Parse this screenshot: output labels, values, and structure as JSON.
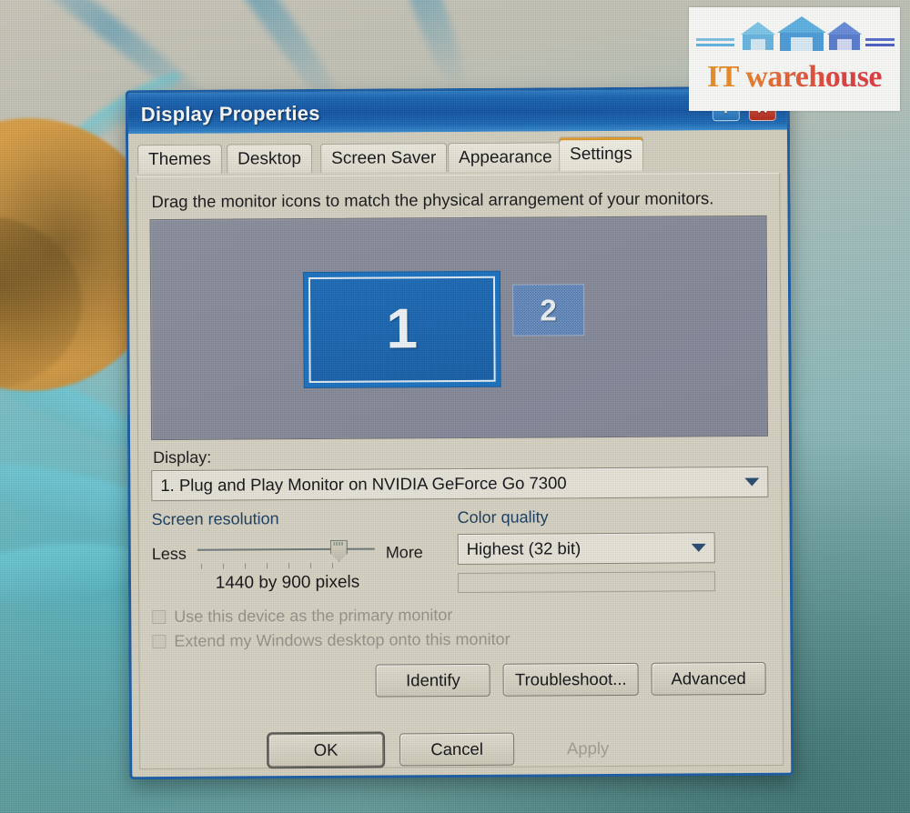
{
  "logo": {
    "text": "IT warehouse",
    "house_count": 3
  },
  "dialog": {
    "title": "Display Properties",
    "titlebar_buttons": [
      {
        "name": "help",
        "glyph": "?"
      },
      {
        "name": "close",
        "glyph": "✕"
      }
    ],
    "tabs": [
      {
        "label": "Themes",
        "active": false
      },
      {
        "label": "Desktop",
        "active": false
      },
      {
        "label": "Screen Saver",
        "active": false
      },
      {
        "label": "Appearance",
        "active": false
      },
      {
        "label": "Settings",
        "active": true
      }
    ],
    "settings": {
      "hint": "Drag the monitor icons to match the physical arrangement of your monitors.",
      "monitors": [
        {
          "number": "1",
          "selected": true
        },
        {
          "number": "2",
          "selected": false
        }
      ],
      "display_label": "Display:",
      "display_value": "1. Plug and Play Monitor on NVIDIA GeForce Go 7300",
      "screen_resolution": {
        "title": "Screen resolution",
        "less_label": "Less",
        "more_label": "More",
        "value_text": "1440 by 900 pixels",
        "slider_percent": 74
      },
      "color_quality": {
        "title": "Color quality",
        "value": "Highest (32 bit)"
      },
      "checkboxes": [
        {
          "label": "Use this device as the primary monitor",
          "checked": false,
          "enabled": false
        },
        {
          "label": "Extend my Windows desktop onto this monitor",
          "checked": false,
          "enabled": false
        }
      ],
      "actions": [
        {
          "label": "Identify"
        },
        {
          "label": "Troubleshoot..."
        },
        {
          "label": "Advanced"
        }
      ]
    },
    "footer": {
      "ok": "OK",
      "cancel": "Cancel",
      "apply": "Apply",
      "apply_enabled": false
    }
  },
  "colors": {
    "titlebar_blue": "#1558a6",
    "active_tab_accent": "#e39b28",
    "dialog_face": "#d9d5c5",
    "monitor_selected": "#1d74c4",
    "preview_bg": "#8d919f",
    "close_red": "#b5291a",
    "logo_orange": "#f0962a",
    "logo_red": "#e03d46"
  }
}
